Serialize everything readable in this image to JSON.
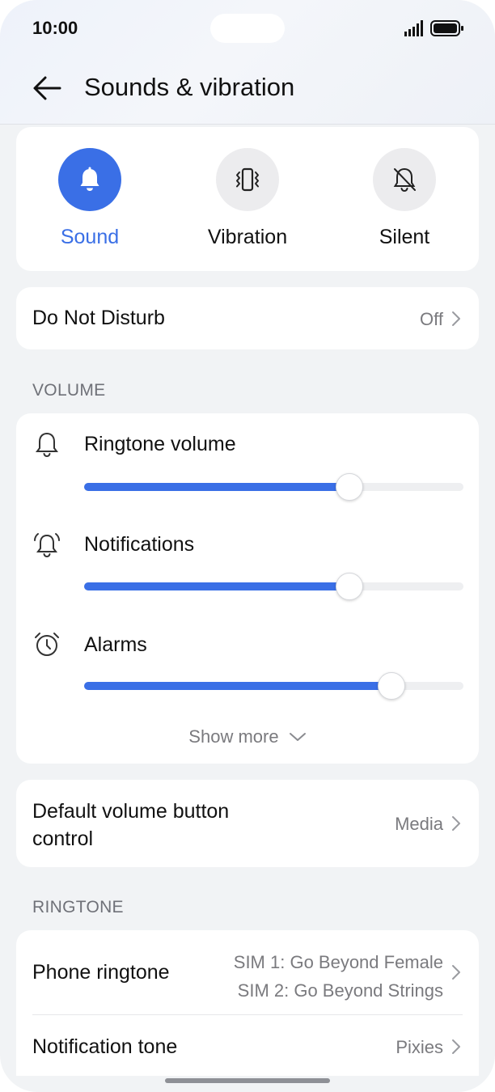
{
  "status_bar": {
    "time": "10:00"
  },
  "header": {
    "title": "Sounds & vibration"
  },
  "modes": [
    {
      "label": "Sound",
      "icon": "bell-icon",
      "active": true
    },
    {
      "label": "Vibration",
      "icon": "vibration-icon",
      "active": false
    },
    {
      "label": "Silent",
      "icon": "bell-off-icon",
      "active": false
    }
  ],
  "dnd": {
    "label": "Do Not Disturb",
    "value": "Off"
  },
  "volume": {
    "section_label": "VOLUME",
    "sliders": [
      {
        "label": "Ringtone volume",
        "icon": "bell-outline-icon",
        "level": 0.7
      },
      {
        "label": "Notifications",
        "icon": "notification-bell-icon",
        "level": 0.7
      },
      {
        "label": "Alarms",
        "icon": "alarm-clock-icon",
        "level": 0.81
      }
    ],
    "show_more": "Show more"
  },
  "default_volume": {
    "label_line1": "Default volume button",
    "label_line2": "control",
    "value": "Media"
  },
  "ringtone": {
    "section_label": "RINGTONE",
    "phone_ringtone": {
      "label": "Phone ringtone",
      "sim1": "SIM 1: Go Beyond Female",
      "sim2": "SIM 2: Go Beyond Strings"
    },
    "notification_tone": {
      "label": "Notification tone",
      "value": "Pixies"
    }
  },
  "colors": {
    "accent": "#3a6fe6",
    "background": "#f1f3f5",
    "card": "#ffffff"
  }
}
